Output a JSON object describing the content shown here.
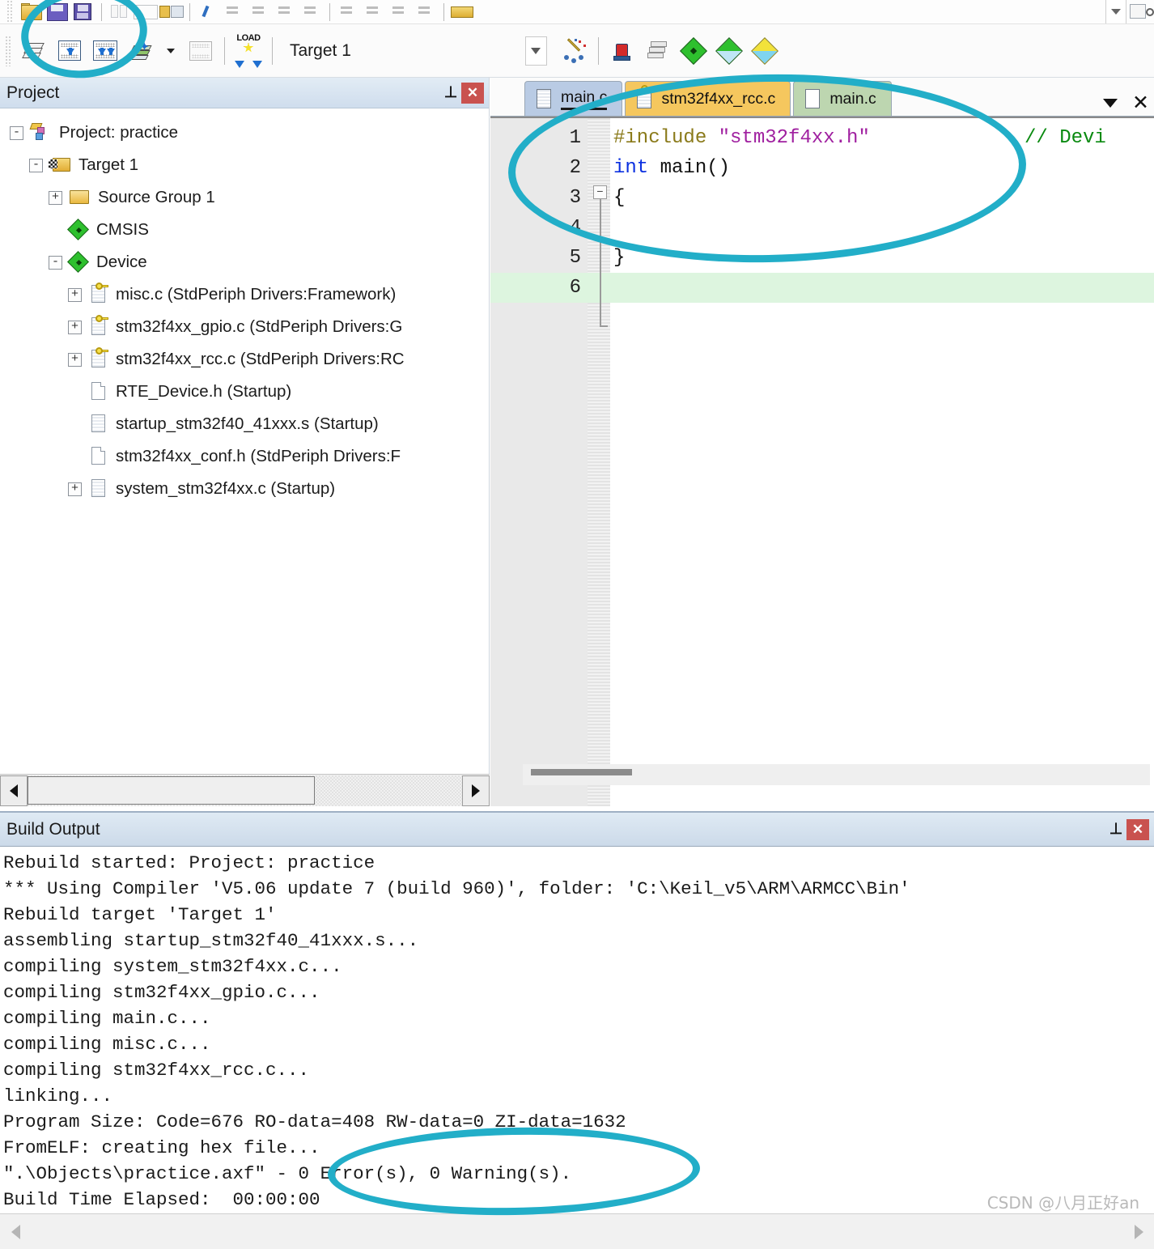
{
  "toolbar": {
    "row1_icons": [
      "open-folder-icon",
      "save-icon",
      "save-all-icon",
      "cut-icon",
      "copy-icon",
      "paste-icon",
      "undo-icon",
      "redo-icon",
      "navigate-back-icon",
      "navigate-forward-icon",
      "bookmark-icon",
      "bookmark-next-icon",
      "bookmark-prev-icon",
      "bookmark-clear-icon",
      "indent-icon",
      "outdent-icon",
      "comment-icon",
      "uncomment-icon",
      "yellow-window-icon"
    ],
    "row2": {
      "translate_icon": "translate-icon",
      "build_icon": "build-icon",
      "rebuild_icon": "rebuild-all-icon",
      "batch_build_icon": "batch-build-icon",
      "batch_dropdown_icon": "caret-down-icon",
      "stop_build_icon": "stop-build-icon",
      "download_icon": "load-download-icon",
      "download_label": "LOAD",
      "target_selector_value": "Target 1",
      "target_dropdown_icon": "chevron-down-icon",
      "wizard_icon": "configuration-wizard-icon",
      "debug_icon": "start-debug-session-icon",
      "sheets_icon": "pack-installer-icon",
      "manage_rte_icon": "manage-run-time-environment-icon",
      "pack_filter_icon": "pack-filter-icon",
      "pack_icon": "select-software-packs-icon"
    }
  },
  "project_panel": {
    "title": "Project",
    "pin_icon": "pin-icon",
    "close_icon": "close-icon",
    "tree": [
      {
        "label": "Project: practice",
        "depth": 0,
        "toggle": "-",
        "icon": "project-icon"
      },
      {
        "label": "Target 1",
        "depth": 1,
        "toggle": "-",
        "icon": "target-folder-icon"
      },
      {
        "label": "Source Group 1",
        "depth": 2,
        "toggle": "+",
        "icon": "folder-icon"
      },
      {
        "label": "CMSIS",
        "depth": 2,
        "toggle": "",
        "icon": "component-diamond-icon"
      },
      {
        "label": "Device",
        "depth": 2,
        "toggle": "-",
        "icon": "component-diamond-icon"
      },
      {
        "label": "misc.c (StdPeriph Drivers:Framework)",
        "depth": 3,
        "toggle": "+",
        "icon": "source-file-key-icon"
      },
      {
        "label": "stm32f4xx_gpio.c (StdPeriph Drivers:G",
        "depth": 3,
        "toggle": "+",
        "icon": "source-file-key-icon"
      },
      {
        "label": "stm32f4xx_rcc.c (StdPeriph Drivers:RC",
        "depth": 3,
        "toggle": "+",
        "icon": "source-file-key-icon"
      },
      {
        "label": "RTE_Device.h (Startup)",
        "depth": 3,
        "toggle": "",
        "icon": "header-file-icon"
      },
      {
        "label": "startup_stm32f40_41xxx.s (Startup)",
        "depth": 3,
        "toggle": "",
        "icon": "asm-file-icon"
      },
      {
        "label": "stm32f4xx_conf.h (StdPeriph Drivers:F",
        "depth": 3,
        "toggle": "",
        "icon": "header-file-icon"
      },
      {
        "label": "system_stm32f4xx.c (Startup)",
        "depth": 3,
        "toggle": "+",
        "icon": "source-file-icon"
      }
    ],
    "hscroll": {
      "left_arrow_icon": "scroll-left-icon",
      "right_arrow_icon": "scroll-right-icon"
    }
  },
  "editor": {
    "tabs": [
      {
        "label": "main.c",
        "state": "active",
        "icon": "source-file-icon"
      },
      {
        "label": "stm32f4xx_rcc.c",
        "state": "modified",
        "icon": "source-file-key-icon"
      },
      {
        "label": "main.c",
        "state": "inactive",
        "icon": "source-file-icon"
      }
    ],
    "tab_list_icon": "caret-down-icon",
    "tab_close_icon": "close-icon",
    "code": [
      {
        "num": "1",
        "text": "#include \"stm32f4xx.h\"",
        "comment": "// Devi",
        "fold": ""
      },
      {
        "num": "2",
        "text": "int main()",
        "comment": "",
        "fold": ""
      },
      {
        "num": "3",
        "text": "{",
        "comment": "",
        "fold": "-"
      },
      {
        "num": "4",
        "text": "",
        "comment": "",
        "fold": ""
      },
      {
        "num": "5",
        "text": "}",
        "comment": "",
        "fold": ""
      },
      {
        "num": "6",
        "text": "",
        "comment": "",
        "fold": "",
        "current": true
      }
    ]
  },
  "build_output": {
    "title": "Build Output",
    "pin_icon": "pin-icon",
    "close_icon": "close-icon",
    "lines": [
      "Rebuild started: Project: practice",
      "*** Using Compiler 'V5.06 update 7 (build 960)', folder: 'C:\\Keil_v5\\ARM\\ARMCC\\Bin'",
      "Rebuild target 'Target 1'",
      "assembling startup_stm32f40_41xxx.s...",
      "compiling system_stm32f4xx.c...",
      "compiling stm32f4xx_gpio.c...",
      "compiling main.c...",
      "compiling misc.c...",
      "compiling stm32f4xx_rcc.c...",
      "linking...",
      "Program Size: Code=676 RO-data=408 RW-data=0 ZI-data=1632",
      "FromELF: creating hex file...",
      "\".\\Objects\\practice.axf\" - 0 Error(s), 0 Warning(s).",
      "Build Time Elapsed:  00:00:00"
    ],
    "scroll": {
      "left_arrow_icon": "scroll-left-icon",
      "right_arrow_icon": "scroll-right-icon"
    }
  },
  "watermark": "CSDN @八月正好an",
  "annotations": {
    "color": "#22aec8",
    "items": [
      {
        "name": "build-buttons-highlight",
        "target": "build and rebuild toolbar buttons"
      },
      {
        "name": "editor-code-highlight",
        "target": "main.c editor tabs and source code"
      },
      {
        "name": "build-result-highlight",
        "target": "0 Error(s), 0 Warning(s) result"
      }
    ]
  }
}
